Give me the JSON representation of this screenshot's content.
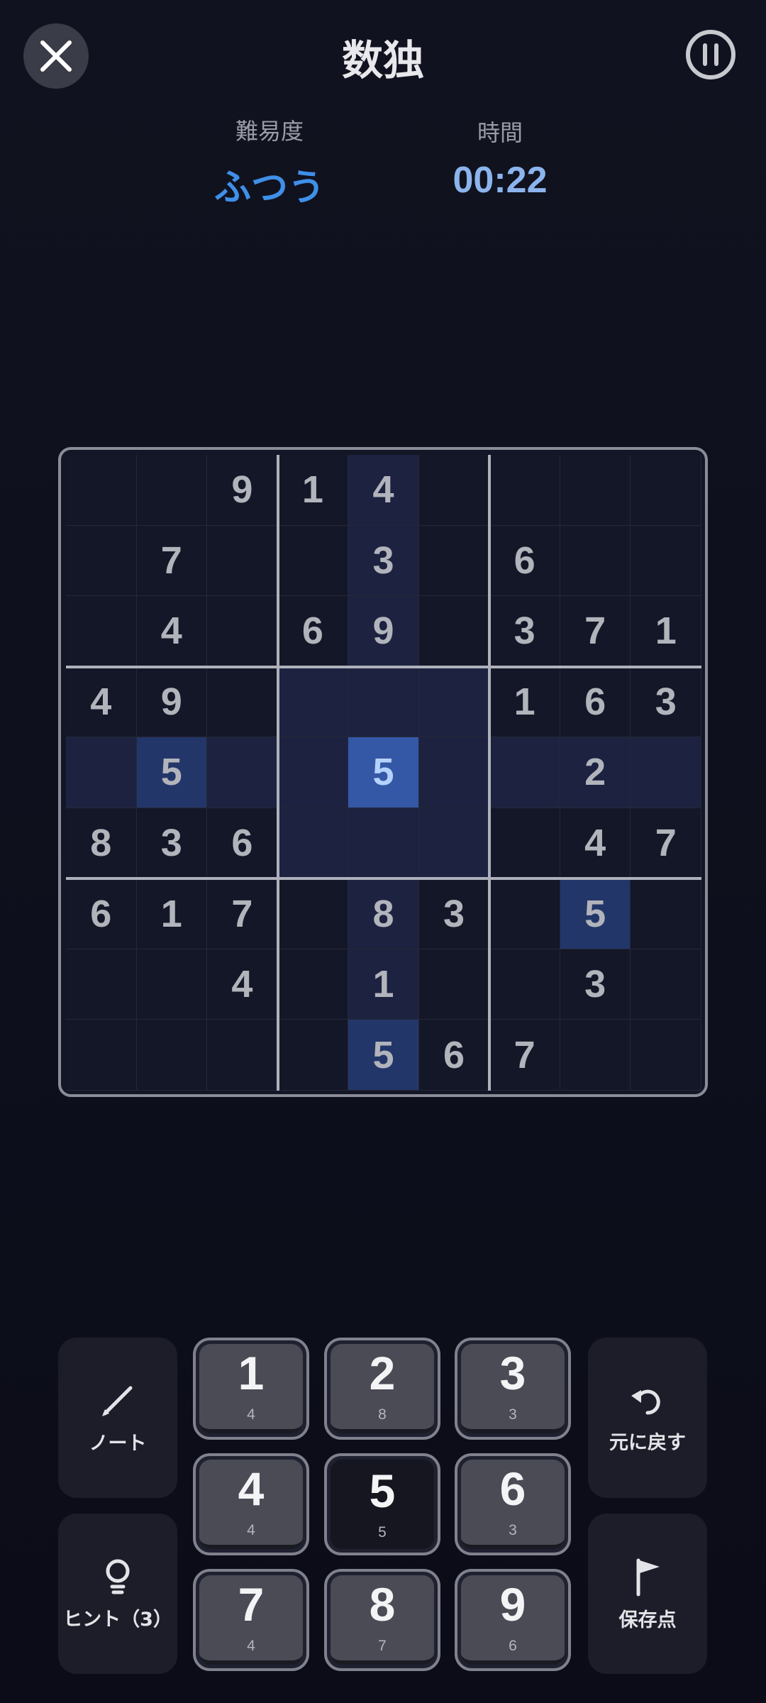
{
  "header": {
    "title": "数独",
    "close_icon": "close-icon",
    "pause_icon": "pause-icon"
  },
  "stats": {
    "difficulty_label": "難易度",
    "difficulty_value": "ふつう",
    "time_label": "時間",
    "time_value": "00:22"
  },
  "board": {
    "rows": [
      [
        "",
        "",
        "9",
        "1",
        "4",
        "",
        "",
        "",
        ""
      ],
      [
        "",
        "7",
        "",
        "",
        "3",
        "",
        "6",
        "",
        ""
      ],
      [
        "",
        "4",
        "",
        "6",
        "9",
        "",
        "3",
        "7",
        "1"
      ],
      [
        "4",
        "9",
        "",
        "",
        "",
        "",
        "1",
        "6",
        "3"
      ],
      [
        "",
        "5",
        "",
        "",
        "5",
        "",
        "",
        "2",
        ""
      ],
      [
        "8",
        "3",
        "6",
        "",
        "",
        "",
        "",
        "4",
        "7"
      ],
      [
        "6",
        "1",
        "7",
        "",
        "8",
        "3",
        "",
        "5",
        ""
      ],
      [
        "",
        "",
        "4",
        "",
        "1",
        "",
        "",
        "3",
        ""
      ],
      [
        "",
        "",
        "",
        "",
        "5",
        "6",
        "7",
        "",
        ""
      ]
    ],
    "selected_cell": [
      4,
      4
    ],
    "highlight_value": "5",
    "colors": {
      "selected": "#3558a6",
      "same_value": "#233669",
      "related": "#1c2240"
    }
  },
  "tools": {
    "note": {
      "label": "ノート",
      "icon": "pencil-icon"
    },
    "hint": {
      "label": "ヒント（3）",
      "icon": "lightbulb-icon"
    },
    "undo": {
      "label": "元に戻す",
      "icon": "undo-icon"
    },
    "save": {
      "label": "保存点",
      "icon": "flag-icon"
    }
  },
  "numpad": [
    {
      "digit": "1",
      "remaining": "4"
    },
    {
      "digit": "2",
      "remaining": "8"
    },
    {
      "digit": "3",
      "remaining": "3"
    },
    {
      "digit": "4",
      "remaining": "4"
    },
    {
      "digit": "5",
      "remaining": "5"
    },
    {
      "digit": "6",
      "remaining": "3"
    },
    {
      "digit": "7",
      "remaining": "4"
    },
    {
      "digit": "8",
      "remaining": "7"
    },
    {
      "digit": "9",
      "remaining": "6"
    }
  ],
  "numpad_active_digit": "5"
}
